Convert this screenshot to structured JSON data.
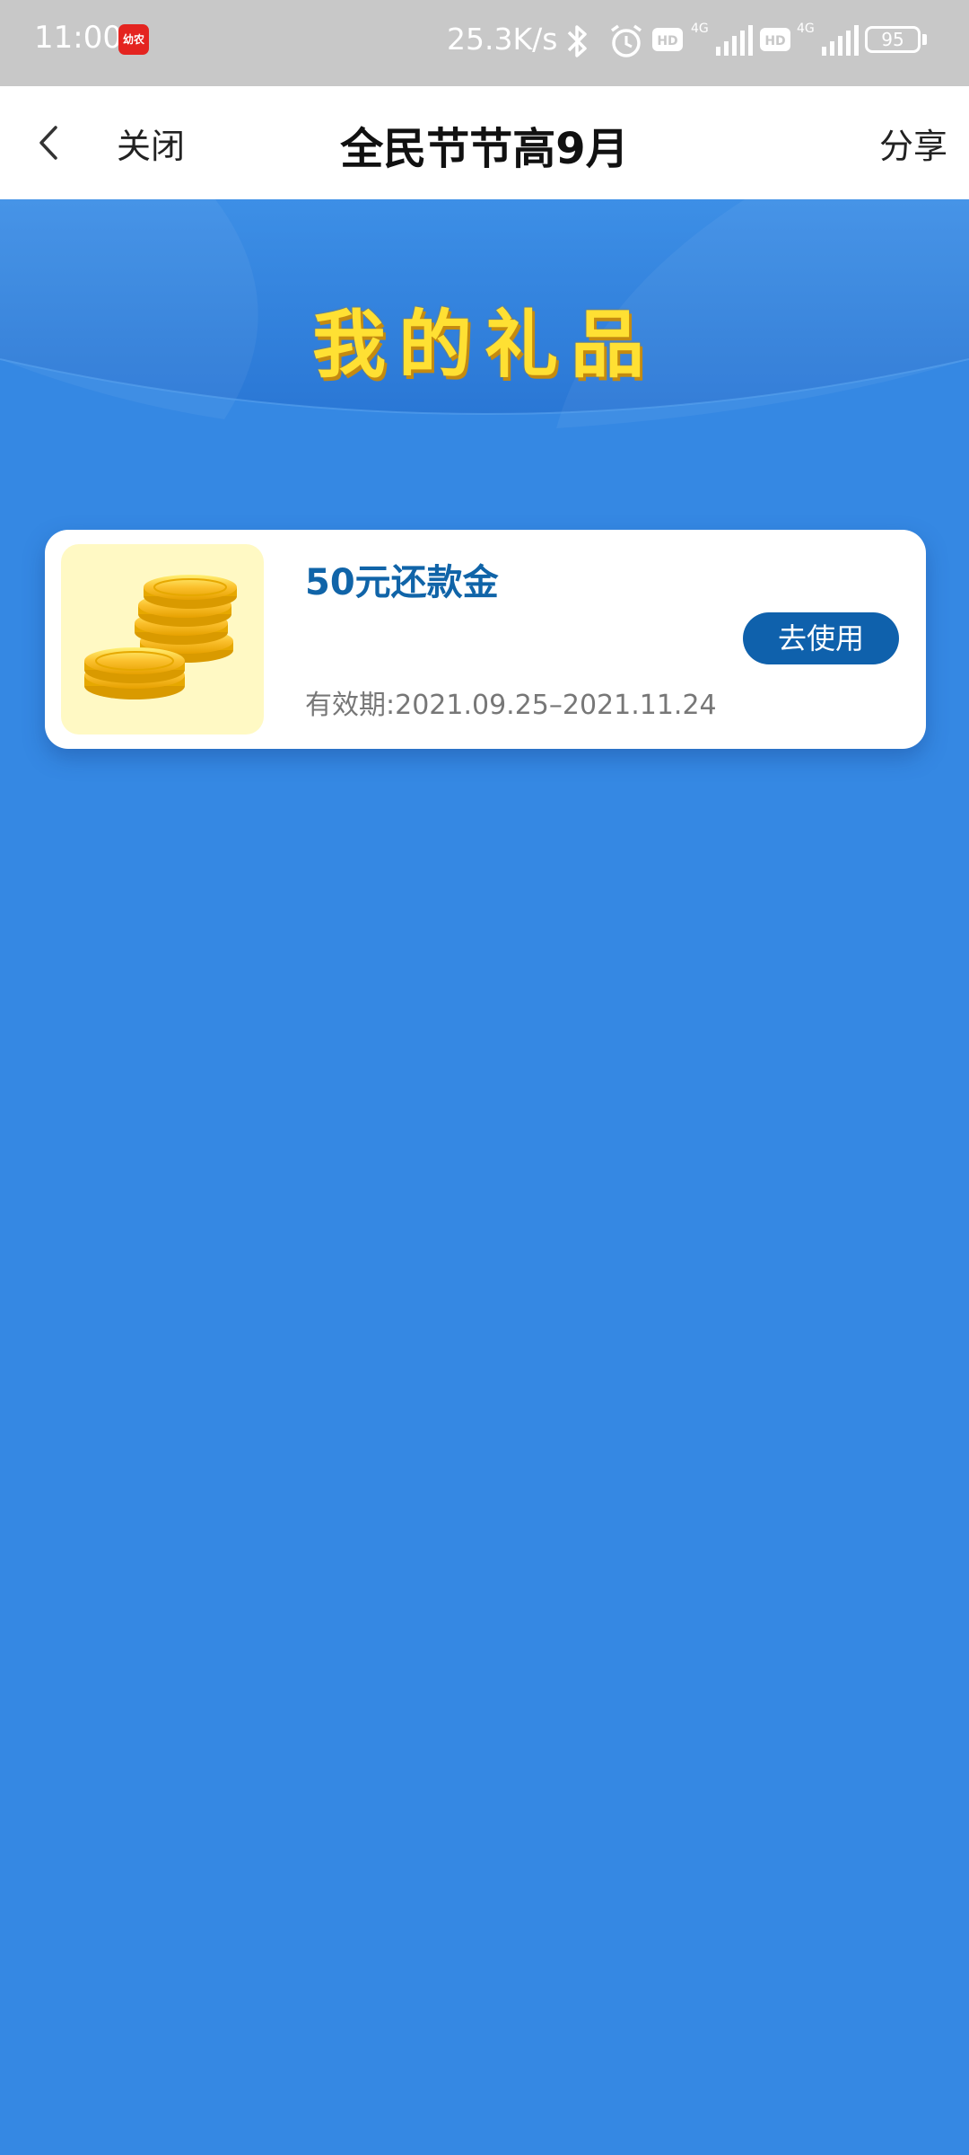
{
  "status_bar": {
    "time": "11:00",
    "app_icon_text": "幼农",
    "net_speed": "25.3K/s",
    "battery": "95",
    "hd_label": "HD",
    "network_label": "4G"
  },
  "nav": {
    "close_label": "关闭",
    "title": "全民节节高9月",
    "share_label": "分享"
  },
  "banner": {
    "title": "我的礼品"
  },
  "gifts": [
    {
      "name": "50元还款金",
      "validity": "有效期:2021.09.25–2021.11.24",
      "button_label": "去使用",
      "icon": "gold-coins-icon"
    }
  ],
  "colors": {
    "background": "#3588e3",
    "accent_blue": "#0f61ac",
    "gift_name": "#1064a8",
    "banner_title": "#ffe033",
    "thumb_bg": "#fff9c4"
  }
}
